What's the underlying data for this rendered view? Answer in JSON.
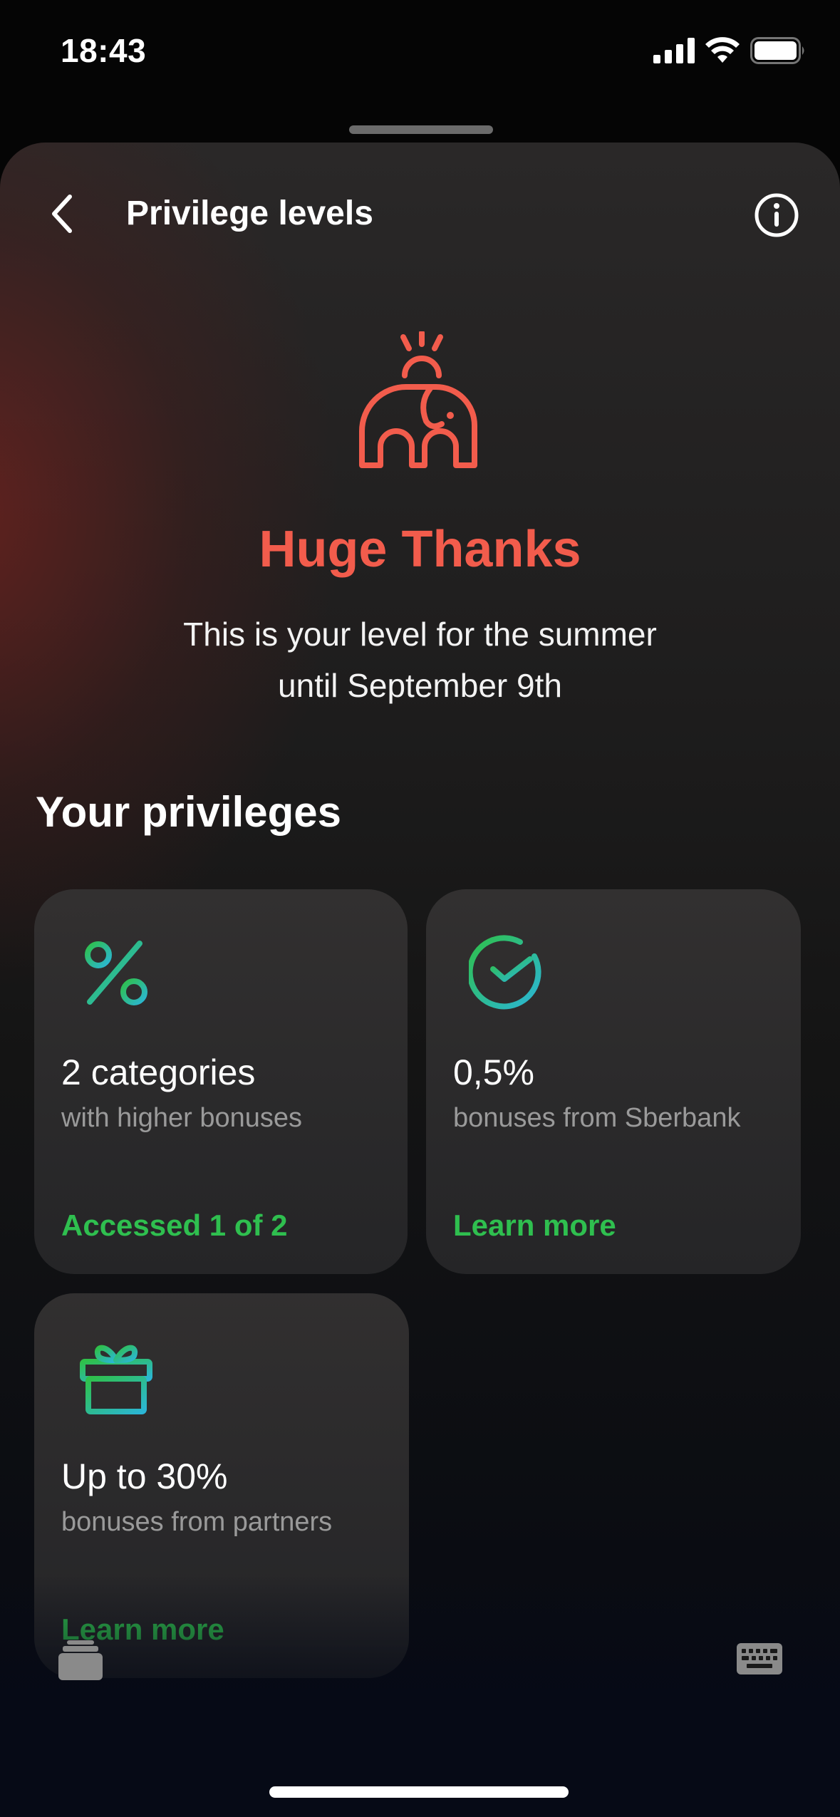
{
  "status_bar": {
    "time": "18:43",
    "icons": [
      "cellular-signal-icon",
      "wifi-icon",
      "battery-icon"
    ]
  },
  "header": {
    "title": "Privilege levels",
    "back_icon": "chevron-left-icon",
    "info_icon": "info-icon"
  },
  "hero": {
    "icon": "elephant-icon",
    "title": "Huge Thanks",
    "subtitle_line1": "This is your level for the summer",
    "subtitle_line2": "until September 9th"
  },
  "privileges": {
    "section_title": "Your privileges",
    "cards": [
      {
        "icon": "percent-icon",
        "value": "2 categories",
        "description": "with higher bonuses",
        "action": "Accessed 1 of 2"
      },
      {
        "icon": "check-circle-icon",
        "value": "0,5%",
        "description": "bonuses from Sberbank",
        "action": "Learn more"
      },
      {
        "icon": "gift-icon",
        "value": "Up to 30%",
        "description": "bonuses from partners",
        "action": "Learn more"
      }
    ]
  },
  "colors": {
    "accent_red": "#f25c4c",
    "accent_green": "#2fbf4f",
    "gradient_teal": "#2bb6d6"
  },
  "toolbar": {
    "left_icon": "stack-icon",
    "right_icon": "keyboard-icon"
  }
}
